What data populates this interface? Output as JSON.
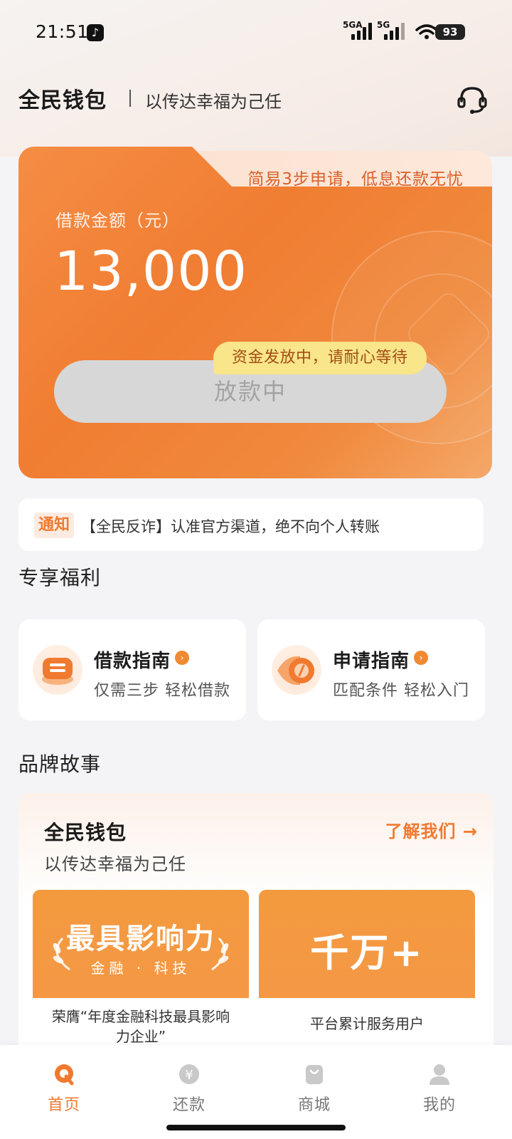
{
  "status_bar": {
    "time": "21:51",
    "signal1_label": "5GA",
    "signal2_label": "5G",
    "battery": "93"
  },
  "header": {
    "app_title": "全民钱包",
    "slogan": "以传达幸福为己任",
    "service_icon": "customer-service-headset-icon"
  },
  "loan_card": {
    "tab_text": "简易3步申请，低息还款无忧",
    "amount_label": "借款金额（元）",
    "amount_value": "13,000",
    "button_label": "放款中",
    "tooltip": "资金发放中，请耐心等待"
  },
  "notice": {
    "badge": "通知",
    "text": "【全民反诈】认准官方渠道，绝不向个人转账"
  },
  "benefits": {
    "section_title": "专享福利",
    "items": [
      {
        "title": "借款指南",
        "subtitle": "仅需三步 轻松借款",
        "icon": "loan-guide-icon"
      },
      {
        "title": "申请指南",
        "subtitle": "匹配条件 轻松入门",
        "icon": "apply-guide-icon"
      }
    ]
  },
  "brand": {
    "section_title": "品牌故事",
    "name": "全民钱包",
    "slogan": "以传达幸福为己任",
    "link": "了解我们 →",
    "stories": [
      {
        "headline": "最具影响力",
        "subline": "金融 · 科技",
        "caption": "荣膺“年度金融科技最具影响力企业”"
      },
      {
        "headline": "千万+",
        "caption": "平台累计服务用户"
      }
    ]
  },
  "bottom_nav": {
    "items": [
      {
        "label": "首页",
        "icon": "home-icon",
        "active": true
      },
      {
        "label": "还款",
        "icon": "repay-yen-icon",
        "active": false
      },
      {
        "label": "商城",
        "icon": "shop-bag-icon",
        "active": false
      },
      {
        "label": "我的",
        "icon": "profile-icon",
        "active": false
      }
    ]
  },
  "colors": {
    "accent": "#f07a2f",
    "card_orange": "#f07d32",
    "tooltip_yellow": "#f9e58a"
  }
}
